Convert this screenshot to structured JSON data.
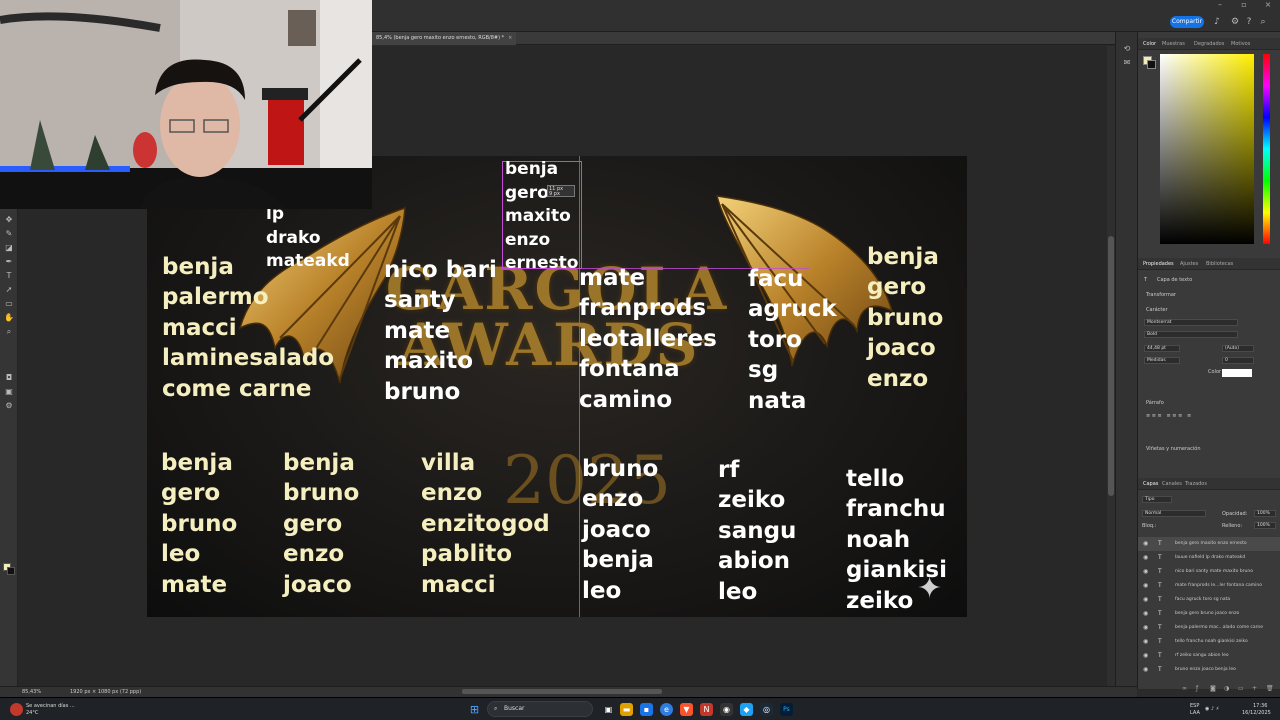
{
  "app": {
    "share_label": "Compartir",
    "doc_tab": "85,4% (benja gero maxito enzo ernesto, RGB/8#) *",
    "tab_close": "×",
    "zoom_status": "85,43%",
    "doc_size_status": "1920 px × 1080 px (72 ppp)",
    "accent_color": "#1473e6"
  },
  "canvas": {
    "lists": [
      {
        "id": "top-small",
        "style": "small",
        "items": [
          "lp",
          "drako",
          "mateakd"
        ]
      },
      {
        "id": "selected-text",
        "style": "small",
        "items": [
          "benja",
          "gero",
          "maxito",
          "enzo",
          "ernesto"
        ]
      },
      {
        "id": "left-1",
        "style": "gold",
        "items": [
          "benja",
          "palermo",
          "macci",
          "laminesalado",
          "come carne"
        ]
      },
      {
        "id": "mid-1",
        "style": "white",
        "items": [
          "nico bari",
          "santy",
          "mate",
          "maxito",
          "bruno"
        ]
      },
      {
        "id": "mid-2",
        "style": "white",
        "items": [
          "mate",
          "franprods",
          "leotalleres",
          "fontana",
          "camino"
        ]
      },
      {
        "id": "mid-3",
        "style": "white",
        "items": [
          "facu",
          "agruck",
          "toro",
          "sg",
          "nata"
        ]
      },
      {
        "id": "right-1",
        "style": "gold",
        "items": [
          "benja",
          "gero",
          "bruno",
          "joaco",
          "enzo"
        ]
      },
      {
        "id": "bottom-1",
        "style": "gold",
        "items": [
          "benja",
          "gero",
          "bruno",
          " leo",
          "mate"
        ]
      },
      {
        "id": "bottom-2",
        "style": "gold",
        "items": [
          "benja",
          "bruno",
          "gero",
          "enzo",
          "joaco"
        ]
      },
      {
        "id": "bottom-3",
        "style": "gold",
        "items": [
          "villa",
          "enzo",
          "enzitogod",
          "pablito",
          "macci"
        ]
      },
      {
        "id": "bottom-4",
        "style": "white",
        "items": [
          "bruno",
          "enzo",
          "joaco",
          "benja",
          "leo"
        ]
      },
      {
        "id": "bottom-5",
        "style": "white",
        "items": [
          "rf",
          "zeiko",
          "sangu",
          "abion",
          "leo"
        ]
      },
      {
        "id": "bottom-6",
        "style": "white",
        "items": [
          "tello",
          "franchu",
          "noah",
          "giankisi",
          "zeiko"
        ]
      }
    ],
    "logo_title": "GARGOLA",
    "logo_subtitle": "AWARDS",
    "logo_tm": "™",
    "logo_year": "2025",
    "measure_text": "11 px",
    "measure_text2": "9 px"
  },
  "panels": {
    "color_tabs": [
      "Color",
      "Muestras",
      "Degradados",
      "Motivos"
    ],
    "properties_tabs": [
      "Propiedades",
      "Ajustes",
      "Bibliotecas"
    ],
    "text_layer_label": "Capa de texto",
    "transform_label": "Transformar",
    "character_label": "Carácter",
    "font_family": "Montserrat",
    "font_style": "Bold",
    "font_size": "44,48 pt",
    "leading": "(Auto)",
    "tracking_label": "Medidas",
    "kerning": "0",
    "color_label": "Color",
    "paragraph_label": "Párrafo",
    "bullets_label": "Viñetas y numeración",
    "layers_tabs": [
      "Capas",
      "Canales",
      "Trazados"
    ],
    "kind_filter": "Tipo",
    "blend_mode": "Normal",
    "opacity_label": "Opacidad:",
    "opacity_value": "100%",
    "lock_label": "Bloq.:",
    "fill_label": "Relleno:",
    "fill_value": "100%",
    "layers": [
      "benja gero maxito enzo ernesto",
      "lauue nafield lp drako mateakd",
      "nico bari santy mate maxito bruno",
      "mate franprods le...ler fontana camino",
      "facu agruck toro sg nata",
      "benja gero bruno joaco enzo",
      "benja palermo mac...alado come carne",
      "tello franchu noah giankisi zeiko",
      "rf zeiko sangu abion leo",
      "bruno enzo joaco benja leo"
    ]
  },
  "taskbar": {
    "weather_title": "Se avecinan días ...",
    "weather_temp": "24°C",
    "search_placeholder": "Buscar",
    "lang_top": "ESP",
    "lang_bottom": "LAA",
    "time": "17:36",
    "date": "16/12/2025"
  }
}
